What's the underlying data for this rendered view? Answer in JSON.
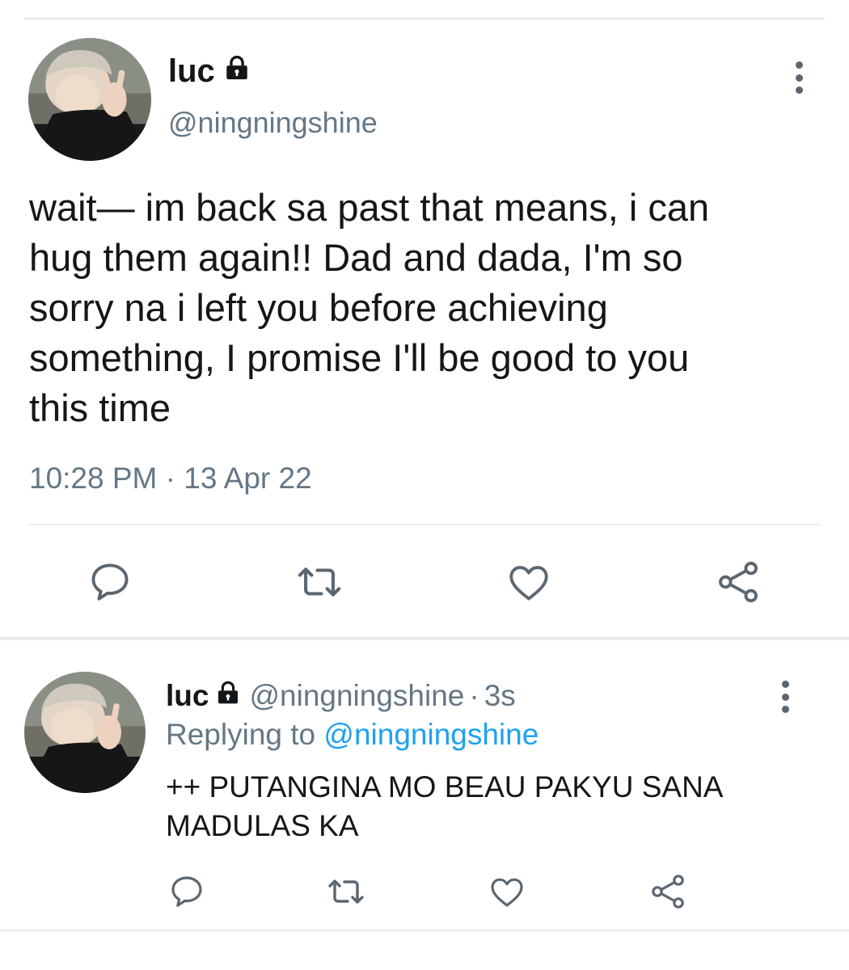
{
  "main_tweet": {
    "display_name": "luc",
    "handle": "@ningningshine",
    "text": "wait— im back sa past that means, i can\nhug them again!! Dad and dada, I'm so\nsorry na i left you before achieving\nsomething, I promise I'll be good to you\nthis time",
    "timestamp": "10:28 PM · 13 Apr 22",
    "icons": {
      "lock": "lock-icon",
      "more": "more-vertical-icon",
      "reply": "reply-icon",
      "retweet": "retweet-icon",
      "like": "heart-icon",
      "share": "share-icon"
    }
  },
  "reply_tweet": {
    "display_name": "luc",
    "handle": "@ningningshine",
    "separator": "·",
    "time": "3s",
    "replying_prefix": "Replying to",
    "replying_to": "@ningningshine",
    "text": "++ PUTANGINA MO BEAU PAKYU SANA MADULAS KA"
  },
  "colors": {
    "text_primary": "#14171a",
    "text_secondary": "#657786",
    "link": "#1da1f2",
    "icon": "#5b6670",
    "divider": "#e6ecf0"
  }
}
